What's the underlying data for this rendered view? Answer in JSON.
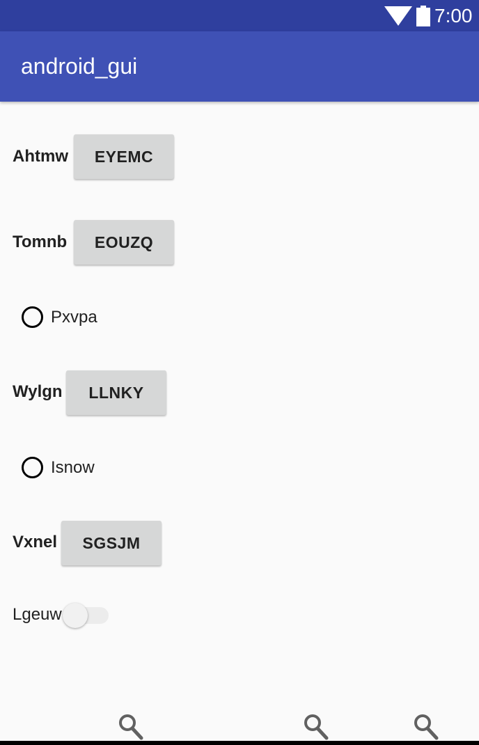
{
  "status_bar": {
    "time": "7:00",
    "icons": [
      "wifi-icon",
      "battery-icon"
    ],
    "background_color": "#2f3f9e"
  },
  "app_bar": {
    "title": "android_gui",
    "background_color": "#3f51b5"
  },
  "rows": {
    "row1": {
      "label": "Ahtmw",
      "button": "EYEMC"
    },
    "row2": {
      "label": "Tomnb",
      "button": "EOUZQ"
    },
    "row3": {
      "radio_label": "Pxvpa",
      "checked": false
    },
    "row4": {
      "label": "Wylgn",
      "button": "LLNKY"
    },
    "row5": {
      "radio_label": "Isnow",
      "checked": false
    },
    "row6": {
      "label": "Vxnel",
      "button": "SGSJM"
    },
    "row7": {
      "switch_label": "Lgeuw",
      "switch_on": false
    }
  },
  "bottom_bar": {
    "icons": [
      "search-icon",
      "search-icon",
      "search-icon"
    ]
  }
}
